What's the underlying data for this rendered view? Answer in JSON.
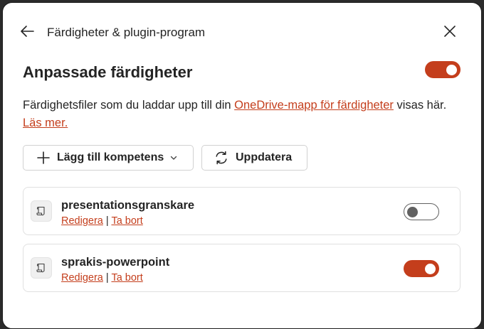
{
  "header": {
    "back_icon": "arrow-left-icon",
    "title": "Färdigheter & plugin-program",
    "close_icon": "close-icon"
  },
  "section": {
    "title": "Anpassade färdigheter",
    "enabled": true
  },
  "description": {
    "text_before": "Färdighetsfiler som du laddar upp till din ",
    "link_text": "OneDrive-mapp för färdigheter",
    "text_after": " visas här. ",
    "learn_more": "Läs mer."
  },
  "toolbar": {
    "add_label": "Lägg till kompetens",
    "update_label": "Uppdatera"
  },
  "skills": [
    {
      "name": "presentationsgranskare",
      "edit": "Redigera",
      "separator": "|",
      "remove": "Ta bort",
      "enabled": false
    },
    {
      "name": "sprakis-powerpoint",
      "edit": "Redigera",
      "separator": "|",
      "remove": "Ta bort",
      "enabled": true
    }
  ],
  "colors": {
    "accent": "#c43e1c",
    "text": "#242424",
    "border": "#e0e0e0"
  }
}
